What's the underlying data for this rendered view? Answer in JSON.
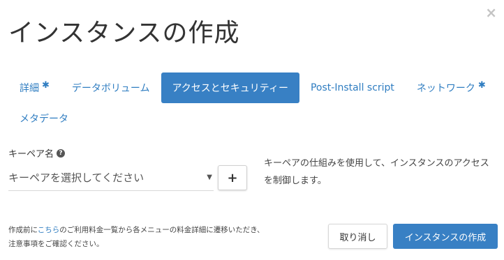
{
  "modal": {
    "title": "インスタンスの作成",
    "close_symbol": "×"
  },
  "tabs": {
    "row1": [
      {
        "label": "詳細",
        "required": "✱",
        "active": false
      },
      {
        "label": "データボリューム",
        "required": "",
        "active": false
      },
      {
        "label": "アクセスとセキュリティー",
        "required": "",
        "active": true
      },
      {
        "label": "Post-Install script",
        "required": "",
        "active": false
      },
      {
        "label": "ネットワーク",
        "required": "✱",
        "active": false
      }
    ],
    "row2": [
      {
        "label": "メタデータ",
        "required": "",
        "active": false
      }
    ]
  },
  "keypair": {
    "label": "キーペア名",
    "help_icon": "question-circle-icon",
    "select_value": "キーペアを選択してください",
    "add_symbol": "+"
  },
  "help": {
    "text": "キーペアの仕組みを使用して、インスタンスのアクセスを制御します。"
  },
  "footer": {
    "note_prefix": "作成前に",
    "note_link": "こちら",
    "note_suffix_line1": "のご利用料金一覧から各メニューの料金詳細に遷移いただき、",
    "note_line2": "注意事項をご確認ください。",
    "cancel_label": "取り消し",
    "create_label": "インスタンスの作成"
  },
  "colors": {
    "accent": "#3880c4",
    "link": "#2f7dc1"
  }
}
